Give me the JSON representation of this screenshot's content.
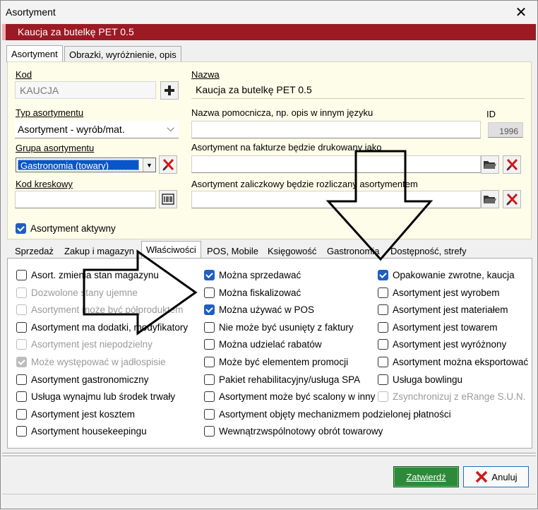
{
  "window": {
    "title": "Asortyment",
    "close_glyph": "✕"
  },
  "header": {
    "name": "Kaucja za butelkę PET 0.5",
    "bar_color": "#9b1a24"
  },
  "top_tabs": [
    {
      "label": "Asortyment",
      "active": true
    },
    {
      "label": "Obrazki, wyróżnienie, opis",
      "active": false
    }
  ],
  "form": {
    "kod": {
      "label": "Kod",
      "value": "KAUCJA"
    },
    "nazwa": {
      "label": "Nazwa",
      "value": "Kaucja za butelkę PET 0.5"
    },
    "typ": {
      "label": "Typ asortymentu",
      "value": "Asortyment - wyrób/mat."
    },
    "nazwa_pomocnicza": {
      "label": "Nazwa pomocnicza, np. opis w innym języku",
      "value": ""
    },
    "id": {
      "label": "ID",
      "value": "1996"
    },
    "grupa": {
      "label": "Grupa asortymentu",
      "value": "Gastronomia (towary)"
    },
    "faktura": {
      "label": "Asortyment na fakturze będzie drukowany jako",
      "value": ""
    },
    "kod_kreskowy": {
      "label": "Kod kreskowy",
      "value": ""
    },
    "zaliczkowy": {
      "label": "Asortyment zaliczkowy będzie rozliczany asortymentem",
      "value": ""
    },
    "aktywny": {
      "label": "Asortyment aktywny",
      "checked": true
    }
  },
  "bottom_tabs": [
    {
      "label": "Sprzedaż",
      "active": false
    },
    {
      "label": "Zakup i magazyn",
      "active": false
    },
    {
      "label": "Właściwości",
      "active": true
    },
    {
      "label": "POS, Mobile",
      "active": false
    },
    {
      "label": "Księgowość",
      "active": false
    },
    {
      "label": "Gastronomia",
      "active": false
    },
    {
      "label": "Dostępność, strefy",
      "active": false
    }
  ],
  "properties": {
    "col1": [
      {
        "label": "Asort. zmienia stan magazynu",
        "checked": false,
        "disabled": false
      },
      {
        "label": "Dozwolone stany ujemne",
        "checked": false,
        "disabled": true
      },
      {
        "label": "Asortyment może być półproduktem",
        "checked": false,
        "disabled": true
      },
      {
        "label": "Asortyment ma dodatki, modyfikatory",
        "checked": false,
        "disabled": false
      },
      {
        "label": "Asortyment jest niepodzielny",
        "checked": false,
        "disabled": true
      },
      {
        "label": "Może występować w jadłospisie",
        "checked": true,
        "disabled": true
      },
      {
        "label": "Asortyment gastronomiczny",
        "checked": false,
        "disabled": false
      },
      {
        "label": "Usługa wynajmu lub środek trwały",
        "checked": false,
        "disabled": false
      },
      {
        "label": "Asortyment jest kosztem",
        "checked": false,
        "disabled": false
      },
      {
        "label": "Asortyment housekeepingu",
        "checked": false,
        "disabled": false
      }
    ],
    "col2": [
      {
        "label": "Można sprzedawać",
        "checked": true,
        "disabled": false
      },
      {
        "label": "Można fiskalizować",
        "checked": false,
        "disabled": false
      },
      {
        "label": "Można używać w POS",
        "checked": true,
        "disabled": false
      },
      {
        "label": "Nie może być usunięty z faktury",
        "checked": false,
        "disabled": false
      },
      {
        "label": "Można udzielać rabatów",
        "checked": false,
        "disabled": false
      },
      {
        "label": "Może być elementem promocji",
        "checked": false,
        "disabled": false
      },
      {
        "label": "Pakiet rehabilitacyjny/usługa SPA",
        "checked": false,
        "disabled": false
      },
      {
        "label": "Asortyment może być scalony w inny",
        "checked": false,
        "disabled": false
      },
      {
        "label": "Asortyment objęty mechanizmem podzielonej płatności",
        "checked": false,
        "disabled": false
      },
      {
        "label": "Wewnątrzwspólnotowy obrót towarowy",
        "checked": false,
        "disabled": false
      }
    ],
    "col3": [
      {
        "label": "Opakowanie zwrotne, kaucja",
        "checked": true,
        "disabled": false
      },
      {
        "label": "Asortyment jest wyrobem",
        "checked": false,
        "disabled": false
      },
      {
        "label": "Asortyment jest materiałem",
        "checked": false,
        "disabled": false
      },
      {
        "label": "Asortyment jest towarem",
        "checked": false,
        "disabled": false
      },
      {
        "label": "Asortyment jest wyróżnony",
        "checked": false,
        "disabled": false
      },
      {
        "label": "Asortyment można eksportować",
        "checked": false,
        "disabled": false
      },
      {
        "label": "Usługa bowlingu",
        "checked": false,
        "disabled": false
      },
      {
        "label": "Zsynchronizuj z eRange S.U.N.",
        "checked": false,
        "disabled": true
      }
    ]
  },
  "buttons": {
    "ok": "Zatwierdź",
    "cancel": "Anuluj"
  }
}
